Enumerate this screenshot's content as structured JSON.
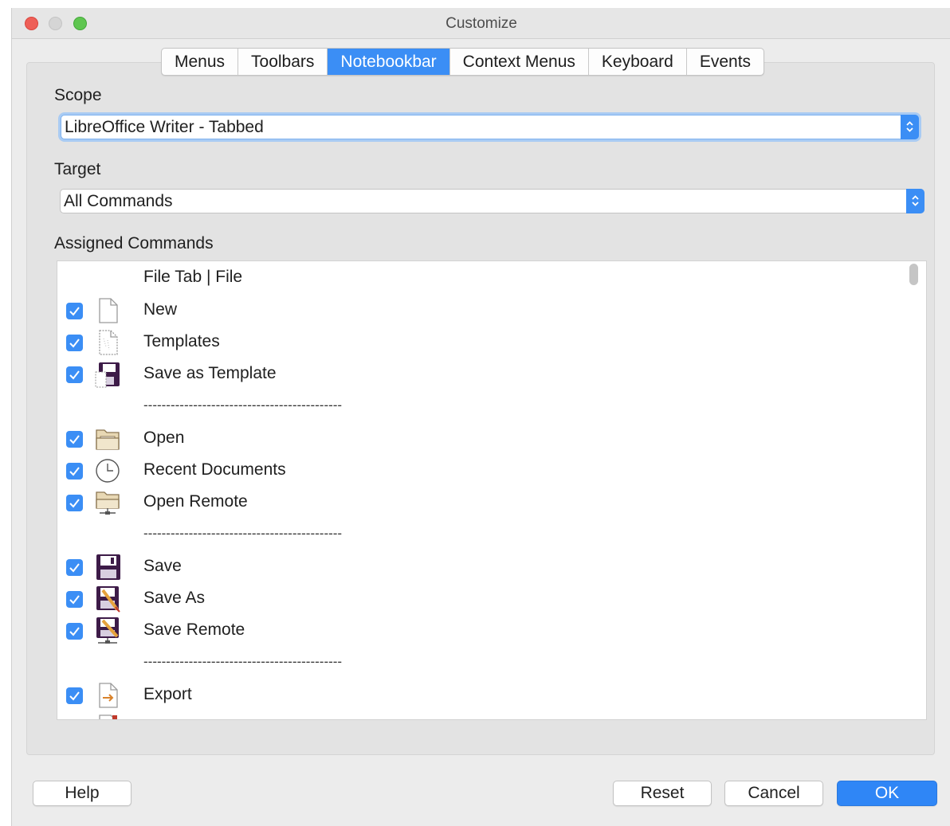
{
  "window": {
    "title": "Customize"
  },
  "tabs": [
    {
      "label": "Menus",
      "active": false
    },
    {
      "label": "Toolbars",
      "active": false
    },
    {
      "label": "Notebookbar",
      "active": true
    },
    {
      "label": "Context Menus",
      "active": false
    },
    {
      "label": "Keyboard",
      "active": false
    },
    {
      "label": "Events",
      "active": false
    }
  ],
  "scope": {
    "label": "Scope",
    "value": "LibreOffice Writer -  Tabbed"
  },
  "target": {
    "label": "Target",
    "value": "All Commands"
  },
  "assigned": {
    "label": "Assigned Commands",
    "header": "File Tab | File",
    "separator": "--------------------------------------------",
    "items": [
      {
        "label": "New",
        "checked": true,
        "icon": "new-document-icon"
      },
      {
        "label": "Templates",
        "checked": true,
        "icon": "templates-icon"
      },
      {
        "label": "Save as Template",
        "checked": true,
        "icon": "save-as-template-icon"
      },
      {
        "separator": true
      },
      {
        "label": "Open",
        "checked": true,
        "icon": "open-folder-icon"
      },
      {
        "label": "Recent Documents",
        "checked": true,
        "icon": "clock-icon"
      },
      {
        "label": "Open Remote",
        "checked": true,
        "icon": "open-remote-icon"
      },
      {
        "separator": true
      },
      {
        "label": "Save",
        "checked": true,
        "icon": "save-icon"
      },
      {
        "label": "Save As",
        "checked": true,
        "icon": "save-as-icon"
      },
      {
        "label": "Save Remote",
        "checked": true,
        "icon": "save-remote-icon"
      },
      {
        "separator": true
      },
      {
        "label": "Export",
        "checked": true,
        "icon": "export-icon"
      }
    ]
  },
  "buttons": {
    "help": "Help",
    "reset": "Reset",
    "cancel": "Cancel",
    "ok": "OK"
  },
  "colors": {
    "accent": "#3b8ef5",
    "checkbox": "#3b8ef5",
    "close": "#ee5f57",
    "zoom": "#5fc650"
  }
}
